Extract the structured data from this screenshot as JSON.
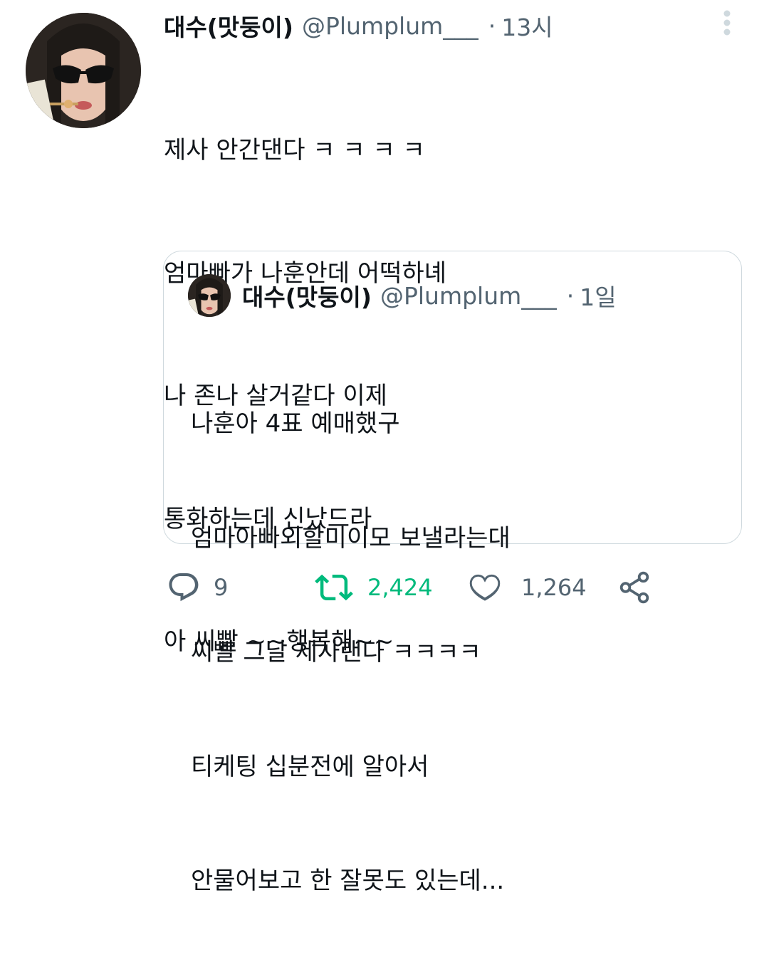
{
  "tweet": {
    "author_name": "대수(맛둥이)",
    "author_handle": "@Plumplum___",
    "separator": "·",
    "time": "13시",
    "lines": [
      "제사 안간댄다 ㅋ ㅋ ㅋ ㅋ",
      "엄마빠가 나훈안데 어떡하녜",
      "나 존나 살거같다 이제",
      "통화하는데 신났드라",
      "아 씨빨 ~~행복해~~"
    ]
  },
  "quoted_tweet": {
    "author_name": "대수(맛둥이)",
    "author_handle": "@Plumplum___",
    "separator": "·",
    "time": "1일",
    "lines": [
      "나훈아 4표 예매했구",
      "엄마아빠외할미이모 보낼라는대",
      "씨빨 그날 제사랜다 ㅋㅋㅋㅋ",
      "티케팅 십분전에 알아서",
      "안물어보고 한 잘못도 있는데..."
    ]
  },
  "actions": {
    "reply_count": "9",
    "retweet_count": "2,424",
    "like_count": "1,264"
  },
  "icons": {
    "reply": "reply-icon",
    "retweet": "retweet-icon",
    "like": "heart-icon",
    "share": "share-icon",
    "more": "more-options-icon"
  },
  "colors": {
    "text_primary": "#0f1419",
    "text_secondary": "#536471",
    "retweet_active": "#00ba7c",
    "border": "#cfd9de"
  }
}
